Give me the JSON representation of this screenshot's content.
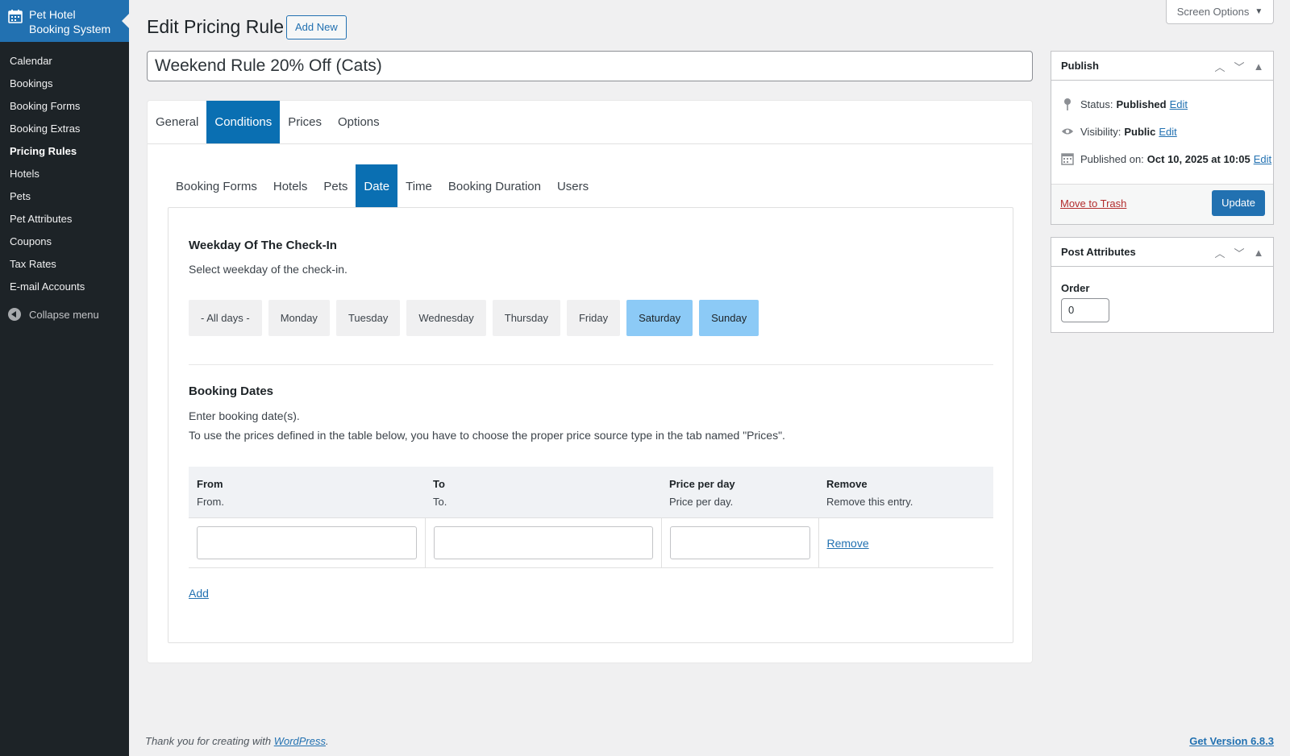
{
  "sidebar": {
    "brand": "Pet Hotel Booking System",
    "items": [
      {
        "label": "Calendar"
      },
      {
        "label": "Bookings"
      },
      {
        "label": "Booking Forms"
      },
      {
        "label": "Booking Extras"
      },
      {
        "label": "Pricing Rules"
      },
      {
        "label": "Hotels"
      },
      {
        "label": "Pets"
      },
      {
        "label": "Pet Attributes"
      },
      {
        "label": "Coupons"
      },
      {
        "label": "Tax Rates"
      },
      {
        "label": "E-mail Accounts"
      }
    ],
    "active": "Pricing Rules",
    "collapse_label": "Collapse menu"
  },
  "header": {
    "screen_options": "Screen Options",
    "title": "Edit Pricing Rule",
    "add_new": "Add New",
    "post_title": "Weekend Rule 20% Off (Cats)"
  },
  "main_tabs": [
    "General",
    "Conditions",
    "Prices",
    "Options"
  ],
  "main_tab_active": "Conditions",
  "sub_tabs": [
    "Booking Forms",
    "Hotels",
    "Pets",
    "Date",
    "Time",
    "Booking Duration",
    "Users"
  ],
  "sub_tab_active": "Date",
  "weekday_section": {
    "title": "Weekday Of The Check-In",
    "description": "Select weekday of the check-in.",
    "options": [
      "- All days -",
      "Monday",
      "Tuesday",
      "Wednesday",
      "Thursday",
      "Friday",
      "Saturday",
      "Sunday"
    ],
    "selected": [
      "Saturday",
      "Sunday"
    ]
  },
  "dates_section": {
    "title": "Booking Dates",
    "description1": "Enter booking date(s).",
    "description2": "To use the prices defined in the table below, you have to choose the proper price source type in the tab named \"Prices\".",
    "columns": [
      {
        "header": "From",
        "desc": "From."
      },
      {
        "header": "To",
        "desc": "To."
      },
      {
        "header": "Price per day",
        "desc": "Price per day."
      },
      {
        "header": "Remove",
        "desc": "Remove this entry."
      }
    ],
    "row": {
      "from": "",
      "to": "",
      "price": "",
      "remove_label": "Remove"
    },
    "add_label": "Add"
  },
  "publish": {
    "title": "Publish",
    "status_label": "Status:",
    "status_value": "Published",
    "visibility_label": "Visibility:",
    "visibility_value": "Public",
    "published_label": "Published on:",
    "published_value": "Oct 10, 2025 at 10:05",
    "edit_label": "Edit",
    "trash_label": "Move to Trash",
    "update_label": "Update"
  },
  "post_attributes": {
    "title": "Post Attributes",
    "order_label": "Order",
    "order_value": "0"
  },
  "footer": {
    "thanks_prefix": "Thank you for creating with",
    "wp_link": "WordPress",
    "thanks_suffix": ".",
    "version": "Get Version 6.8.3"
  },
  "colors": {
    "sidebar_bg": "#1d2327",
    "brand_bg": "#2271b1",
    "tab_active": "#0a6fb2",
    "weekday_selected": "#8ccaf6",
    "link": "#2271b1",
    "trash": "#b32d2e"
  }
}
